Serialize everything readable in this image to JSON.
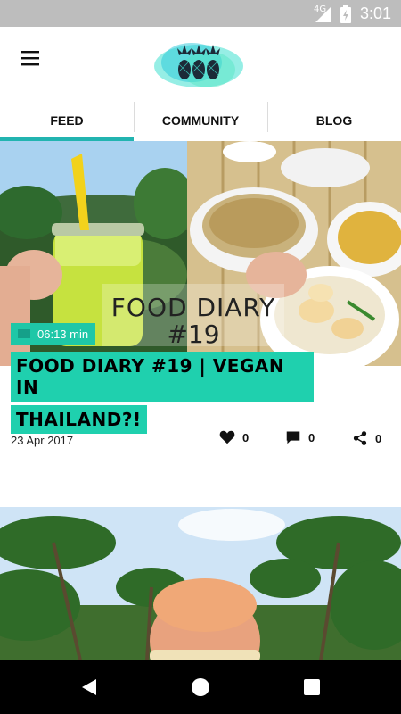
{
  "status_bar": {
    "network": "4G",
    "time": "3:01"
  },
  "app_bar": {
    "menu_icon": "hamburger-menu-icon",
    "logo": "pineapple-logo"
  },
  "tabs": [
    {
      "label": "FEED",
      "active": true
    },
    {
      "label": "COMMUNITY",
      "active": false
    },
    {
      "label": "BLOG",
      "active": false
    }
  ],
  "accent_color": "#22b4b0",
  "posts": [
    {
      "image_text": {
        "line1": "FOOD DIARY",
        "line2": "#19"
      },
      "duration": "06:13 min",
      "title_lines": [
        "FOOD DIARY #19 | VEGAN IN",
        "THAILAND?!"
      ],
      "date": "23 Apr 2017",
      "likes": "0",
      "comments": "0",
      "shares": "0"
    }
  ],
  "nav_bar": {
    "icons": [
      "back-icon",
      "home-icon",
      "recents-icon"
    ]
  }
}
